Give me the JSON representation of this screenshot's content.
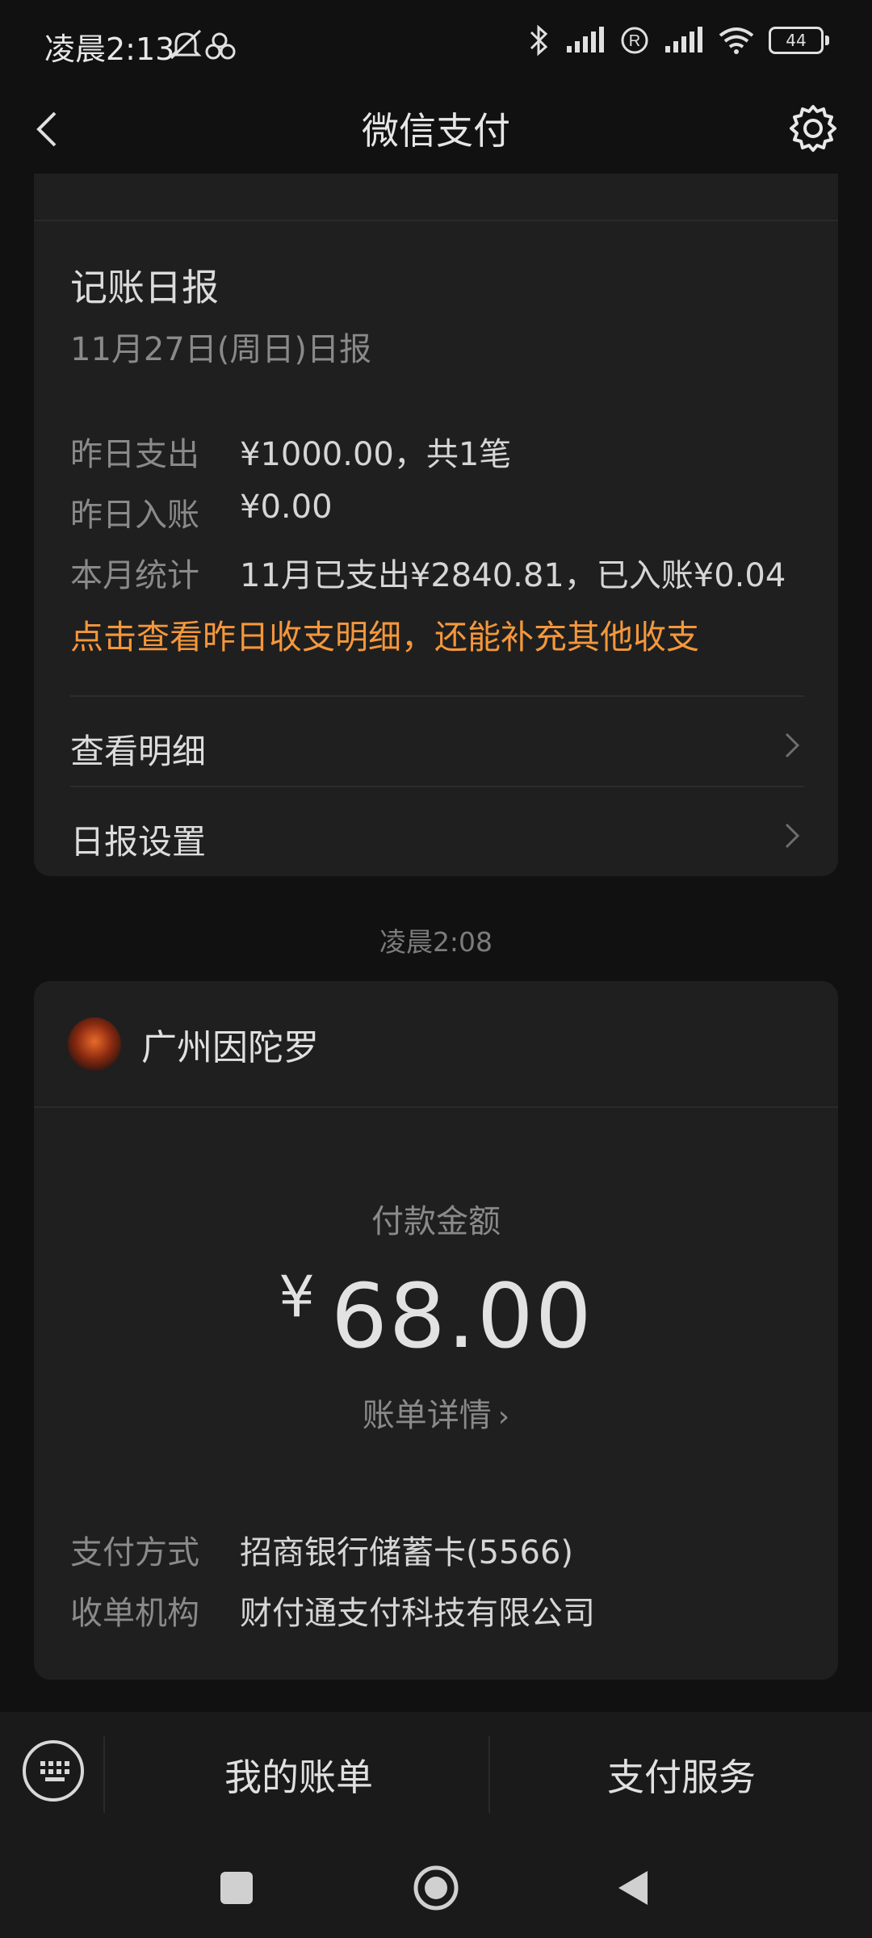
{
  "status_bar": {
    "time": "凌晨2:13",
    "battery": "44"
  },
  "nav": {
    "title": "微信支付"
  },
  "report": {
    "title": "记账日报",
    "subtitle": "11月27日(周日)日报",
    "rows": [
      {
        "label": "昨日支出",
        "value": "¥1000.00，共1笔"
      },
      {
        "label": "昨日入账",
        "value": "¥0.00"
      },
      {
        "label": "本月统计",
        "value": "11月已支出¥2840.81，已入账¥0.04"
      }
    ],
    "hint": "点击查看昨日收支明细，还能补充其他收支",
    "links": [
      "查看明细",
      "日报设置"
    ]
  },
  "timestamp": "凌晨2:08",
  "payment": {
    "merchant": "广州因陀罗",
    "amount_label": "付款金额",
    "currency": "¥",
    "amount": "68.00",
    "bill_detail": "账单详情",
    "details": [
      {
        "label": "支付方式",
        "value": "招商银行储蓄卡(5566)"
      },
      {
        "label": "收单机构",
        "value": "财付通支付科技有限公司"
      }
    ]
  },
  "bottom_bar": {
    "my_bills": "我的账单",
    "pay_service": "支付服务"
  },
  "colors": {
    "accent_orange": "#f4973b",
    "background": "#111111",
    "card": "#1f1f1f"
  }
}
